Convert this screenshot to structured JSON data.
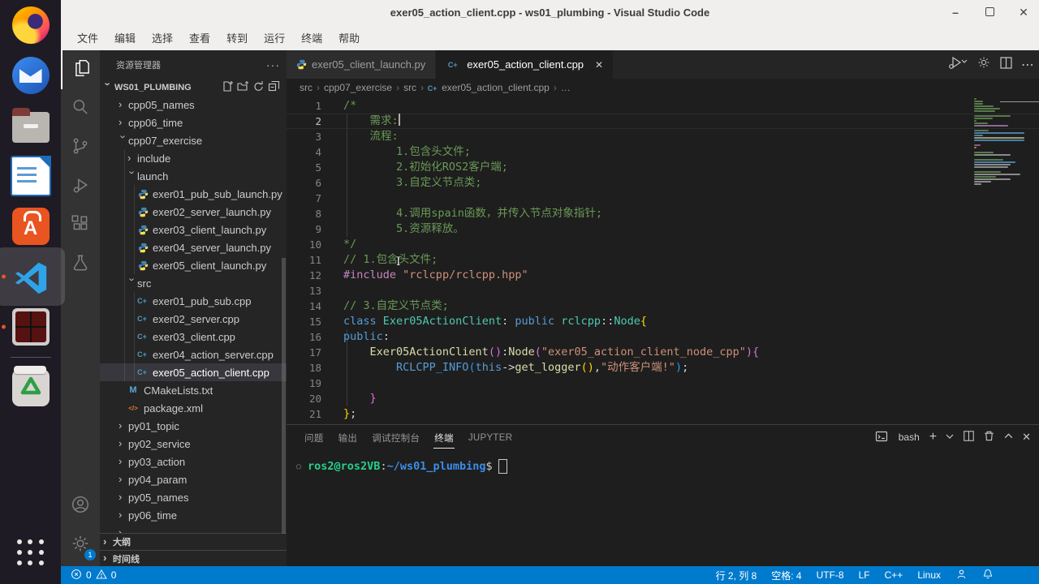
{
  "window": {
    "title": "exer05_action_client.cpp - ws01_plumbing - Visual Studio Code",
    "menus": [
      "文件",
      "编辑",
      "选择",
      "查看",
      "转到",
      "运行",
      "终端",
      "帮助"
    ]
  },
  "dock": {
    "items": [
      "firefox",
      "thunderbird",
      "file-manager",
      "libreoffice-writer",
      "ubuntu-software",
      "vscode",
      "terminal-emulator",
      "trash",
      "show-applications"
    ]
  },
  "activity_bar": {
    "items": [
      {
        "name": "explorer",
        "active": true
      },
      {
        "name": "search"
      },
      {
        "name": "source-control"
      },
      {
        "name": "run-and-debug"
      },
      {
        "name": "extensions"
      },
      {
        "name": "testing"
      }
    ],
    "bottom": [
      {
        "name": "account"
      },
      {
        "name": "settings",
        "badge": "1"
      }
    ]
  },
  "sidebar": {
    "title": "资源管理器",
    "section": "WS01_PLUMBING",
    "tree": [
      {
        "label": "cpp05_names",
        "kind": "folder",
        "state": "collapsed",
        "depth": 0
      },
      {
        "label": "cpp06_time",
        "kind": "folder",
        "state": "collapsed",
        "depth": 0
      },
      {
        "label": "cpp07_exercise",
        "kind": "folder",
        "state": "expanded",
        "depth": 0
      },
      {
        "label": "include",
        "kind": "folder",
        "state": "collapsed",
        "depth": 1
      },
      {
        "label": "launch",
        "kind": "folder",
        "state": "expanded",
        "depth": 1
      },
      {
        "label": "exer01_pub_sub_launch.py",
        "kind": "py",
        "depth": 2
      },
      {
        "label": "exer02_server_launch.py",
        "kind": "py",
        "depth": 2
      },
      {
        "label": "exer03_client_launch.py",
        "kind": "py",
        "depth": 2
      },
      {
        "label": "exer04_server_launch.py",
        "kind": "py",
        "depth": 2
      },
      {
        "label": "exer05_client_launch.py",
        "kind": "py",
        "depth": 2
      },
      {
        "label": "src",
        "kind": "folder",
        "state": "expanded",
        "depth": 1
      },
      {
        "label": "exer01_pub_sub.cpp",
        "kind": "cpp",
        "depth": 2
      },
      {
        "label": "exer02_server.cpp",
        "kind": "cpp",
        "depth": 2
      },
      {
        "label": "exer03_client.cpp",
        "kind": "cpp",
        "depth": 2
      },
      {
        "label": "exer04_action_server.cpp",
        "kind": "cpp",
        "depth": 2
      },
      {
        "label": "exer05_action_client.cpp",
        "kind": "cpp",
        "depth": 2,
        "selected": true
      },
      {
        "label": "CMakeLists.txt",
        "kind": "cmake",
        "depth": 1
      },
      {
        "label": "package.xml",
        "kind": "xml",
        "depth": 1
      },
      {
        "label": "py01_topic",
        "kind": "folder",
        "state": "collapsed",
        "depth": 0
      },
      {
        "label": "py02_service",
        "kind": "folder",
        "state": "collapsed",
        "depth": 0
      },
      {
        "label": "py03_action",
        "kind": "folder",
        "state": "collapsed",
        "depth": 0
      },
      {
        "label": "py04_param",
        "kind": "folder",
        "state": "collapsed",
        "depth": 0
      },
      {
        "label": "py05_names",
        "kind": "folder",
        "state": "collapsed",
        "depth": 0
      },
      {
        "label": "py06_time",
        "kind": "folder",
        "state": "collapsed",
        "depth": 0
      },
      {
        "label": "",
        "kind": "folder",
        "state": "collapsed",
        "depth": 0
      }
    ],
    "bottom_sections": [
      "大纲",
      "时间线"
    ]
  },
  "editor": {
    "tabs": [
      {
        "label": "exer05_client_launch.py",
        "icon": "py",
        "active": false
      },
      {
        "label": "exer05_action_client.cpp",
        "icon": "cpp",
        "active": true
      }
    ],
    "breadcrumb": [
      {
        "label": "src"
      },
      {
        "label": "cpp07_exercise"
      },
      {
        "label": "src"
      },
      {
        "label": "exer05_action_client.cpp",
        "icon": "cpp"
      },
      {
        "label": "…"
      }
    ],
    "code": {
      "current_line": 2,
      "lines": [
        {
          "segs": [
            [
              "/*",
              "cm"
            ]
          ]
        },
        {
          "segs": [
            [
              "    需求:",
              "cm"
            ]
          ],
          "current": true,
          "cursor": true
        },
        {
          "segs": [
            [
              "    流程:",
              "cm"
            ]
          ]
        },
        {
          "segs": [
            [
              "        1.包含头文件;",
              "cm"
            ]
          ]
        },
        {
          "segs": [
            [
              "        2.初始化ROS2客户端;",
              "cm"
            ]
          ]
        },
        {
          "segs": [
            [
              "        3.自定义节点类;",
              "cm"
            ]
          ]
        },
        {
          "segs": []
        },
        {
          "segs": [
            [
              "        4.调用spain函数，并传入节点对象指针;",
              "cm"
            ]
          ]
        },
        {
          "segs": [
            [
              "        5.资源释放。",
              "cm"
            ]
          ]
        },
        {
          "segs": [
            [
              "*/",
              "cm"
            ]
          ]
        },
        {
          "segs": [
            [
              "// 1.包含头文件;",
              "cm"
            ]
          ]
        },
        {
          "segs": [
            [
              "#include",
              "pp"
            ],
            [
              " ",
              "tx"
            ],
            [
              "\"rclcpp/rclcpp.hpp\"",
              "st"
            ]
          ]
        },
        {
          "segs": []
        },
        {
          "segs": [
            [
              "// 3.自定义节点类;",
              "cm"
            ]
          ]
        },
        {
          "segs": [
            [
              "class",
              "kw"
            ],
            [
              " ",
              "tx"
            ],
            [
              "Exer05ActionClient",
              "ty"
            ],
            [
              ": ",
              "tx"
            ],
            [
              "public",
              "kw"
            ],
            [
              " ",
              "tx"
            ],
            [
              "rclcpp",
              "ty"
            ],
            [
              "::",
              "tx"
            ],
            [
              "Node",
              "ty"
            ],
            [
              "{",
              "b1"
            ]
          ]
        },
        {
          "segs": [
            [
              "public",
              "kw"
            ],
            [
              ":",
              "tx"
            ]
          ]
        },
        {
          "segs": [
            [
              "    ",
              "tx"
            ],
            [
              "Exer05ActionClient",
              "fn"
            ],
            [
              "()",
              "b2"
            ],
            [
              ":",
              "tx"
            ],
            [
              "Node",
              "fn"
            ],
            [
              "(",
              "b2"
            ],
            [
              "\"exer05_action_client_node_cpp\"",
              "st"
            ],
            [
              ")",
              "b2"
            ],
            [
              "{",
              "b2"
            ]
          ]
        },
        {
          "segs": [
            [
              "        ",
              "tx"
            ],
            [
              "RCLCPP_INFO",
              "kw"
            ],
            [
              "(",
              "b3"
            ],
            [
              "this",
              "kw"
            ],
            [
              "->",
              "tx"
            ],
            [
              "get_logger",
              "fn"
            ],
            [
              "()",
              "b1"
            ],
            [
              ",",
              "tx"
            ],
            [
              "\"动作客户端!\"",
              "st"
            ],
            [
              ")",
              "b3"
            ],
            [
              ";",
              "tx"
            ]
          ]
        },
        {
          "segs": []
        },
        {
          "segs": [
            [
              "    ",
              "tx"
            ],
            [
              "}",
              "b2"
            ]
          ]
        },
        {
          "segs": [
            [
              "}",
              "b1"
            ],
            [
              ";",
              "tx"
            ]
          ]
        }
      ]
    }
  },
  "panel": {
    "tabs": [
      {
        "label": "问题"
      },
      {
        "label": "输出"
      },
      {
        "label": "调试控制台"
      },
      {
        "label": "终端",
        "active": true
      },
      {
        "label": "JUPYTER"
      }
    ],
    "shell_label": "bash",
    "prompt": {
      "user": "ros2@ros2VB",
      "colon": ":",
      "path": "~/ws01_plumbing",
      "dollar": "$"
    }
  },
  "status_bar": {
    "errors": "0",
    "warnings": "0",
    "right": [
      "行 2, 列 8",
      "空格: 4",
      "UTF-8",
      "LF",
      "C++",
      "Linux"
    ]
  }
}
